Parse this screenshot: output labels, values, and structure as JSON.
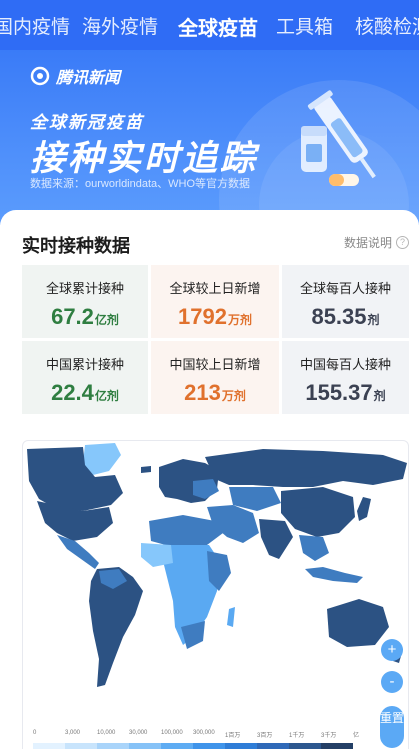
{
  "nav": {
    "tabs": [
      "国内疫情",
      "海外疫情",
      "全球疫苗",
      "工具箱",
      "核酸检测"
    ],
    "active_index": 2
  },
  "banner": {
    "brand": "腾讯新闻",
    "subtitle": "全球新冠疫苗",
    "title": "接种实时追踪",
    "source": "数据来源：ourworldindata、WHO等官方数据"
  },
  "section": {
    "title": "实时接种数据",
    "help": "数据说明"
  },
  "stats": [
    {
      "label": "全球累计接种",
      "value": "67.2",
      "unit": "亿剂",
      "tone": "green"
    },
    {
      "label": "全球较上日新增",
      "value": "1792",
      "unit": "万剂",
      "tone": "orange"
    },
    {
      "label": "全球每百人接种",
      "value": "85.35",
      "unit": "剂",
      "tone": "gray"
    },
    {
      "label": "中国累计接种",
      "value": "22.4",
      "unit": "亿剂",
      "tone": "green"
    },
    {
      "label": "中国较上日新增",
      "value": "213",
      "unit": "万剂",
      "tone": "orange"
    },
    {
      "label": "中国每百人接种",
      "value": "155.37",
      "unit": "剂",
      "tone": "gray"
    }
  ],
  "map": {
    "zoom_in": "+",
    "zoom_out": "-",
    "reset": "重置",
    "legend_ticks": [
      "0",
      "3,000",
      "10,000",
      "30,000",
      "100,000",
      "300,000",
      "1百万",
      "3百万",
      "1千万",
      "3千万",
      "亿"
    ],
    "legend_colors": [
      "#e3f2ff",
      "#c8e4fc",
      "#a9d4fa",
      "#86c2f7",
      "#5eacf3",
      "#3f94ea",
      "#2f7dd7",
      "#2f69b8",
      "#2c578f",
      "#243f66"
    ],
    "colors": {
      "ocean": "#ffffff",
      "dark": "#2c5283",
      "mid": "#3f7cc0",
      "light": "#5aa9f2",
      "pale": "#86c7fb"
    }
  }
}
